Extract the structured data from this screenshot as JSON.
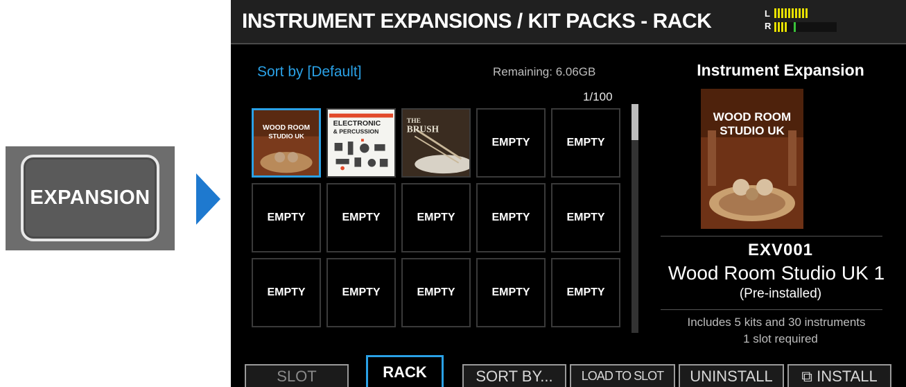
{
  "hardware": {
    "button_label": "EXPANSION"
  },
  "screen": {
    "title": "INSTRUMENT EXPANSIONS / KIT PACKS - RACK",
    "meter": {
      "left_label": "L",
      "right_label": "R"
    },
    "sort_label": "Sort by [Default]",
    "remaining": "Remaining: 6.06GB",
    "page": "1/100",
    "grid": {
      "items": [
        {
          "label": "",
          "art": "wood-room-cover",
          "selected": true
        },
        {
          "label": "",
          "art": "electronic-percussion-cover"
        },
        {
          "label": "",
          "art": "the-brush-cover"
        },
        {
          "label": "EMPTY"
        },
        {
          "label": "EMPTY"
        },
        {
          "label": "EMPTY"
        },
        {
          "label": "EMPTY"
        },
        {
          "label": "EMPTY"
        },
        {
          "label": "EMPTY"
        },
        {
          "label": "EMPTY"
        },
        {
          "label": "EMPTY"
        },
        {
          "label": "EMPTY"
        },
        {
          "label": "EMPTY"
        },
        {
          "label": "EMPTY"
        },
        {
          "label": "EMPTY"
        }
      ],
      "art_text": {
        "wood_room": "WOOD ROOM STUDIO UK",
        "electronic": "ELECTRONIC & PERCUSSION",
        "brush": "THE BRUSH"
      }
    },
    "detail": {
      "title": "Instrument Expansion",
      "art_title_1": "WOOD ROOM",
      "art_title_2": "STUDIO UK",
      "code": "EXV001",
      "name": "Wood Room Studio UK 1",
      "status": "(Pre-installed)",
      "info_line1": "Includes 5 kits and 30 instruments",
      "info_line2": "1 slot required"
    },
    "function_keys": [
      {
        "label": "SLOT",
        "active": false
      },
      {
        "label": "RACK",
        "active": true
      },
      {
        "label": "SORT BY...",
        "active": false
      },
      {
        "label": "LOAD TO SLOT",
        "active": false
      },
      {
        "label": "UNINSTALL",
        "active": false
      },
      {
        "label": "⧉ INSTALL",
        "active": false
      }
    ],
    "colors": {
      "accent": "#2aa1e6",
      "arrow": "#1e79cf",
      "meter": "#e8e000",
      "meter_peak": "#39c23a"
    }
  }
}
